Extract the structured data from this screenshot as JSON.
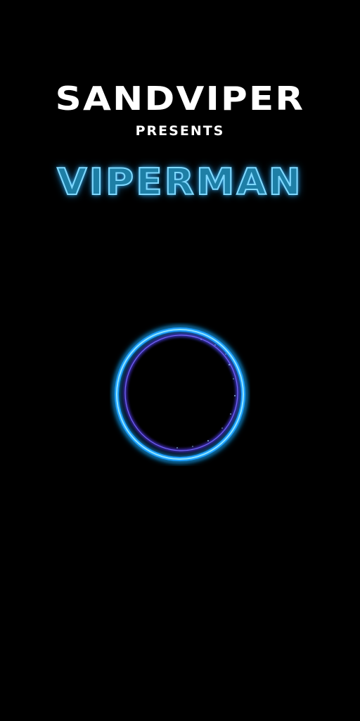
{
  "studio": {
    "name": "SANDVIPER",
    "presents": "PRESENTS"
  },
  "game": {
    "title": "VIPERMAN"
  },
  "loader": {
    "icon": "loading-ring-icon",
    "ring_color": "#1ea0ff",
    "inner_color": "#5a3cff",
    "glow_color": "#00b4ff"
  },
  "colors": {
    "background": "#000000",
    "text": "#ffffff",
    "title_fill": "#1e7fa6",
    "title_outline": "#7fd8ff"
  }
}
